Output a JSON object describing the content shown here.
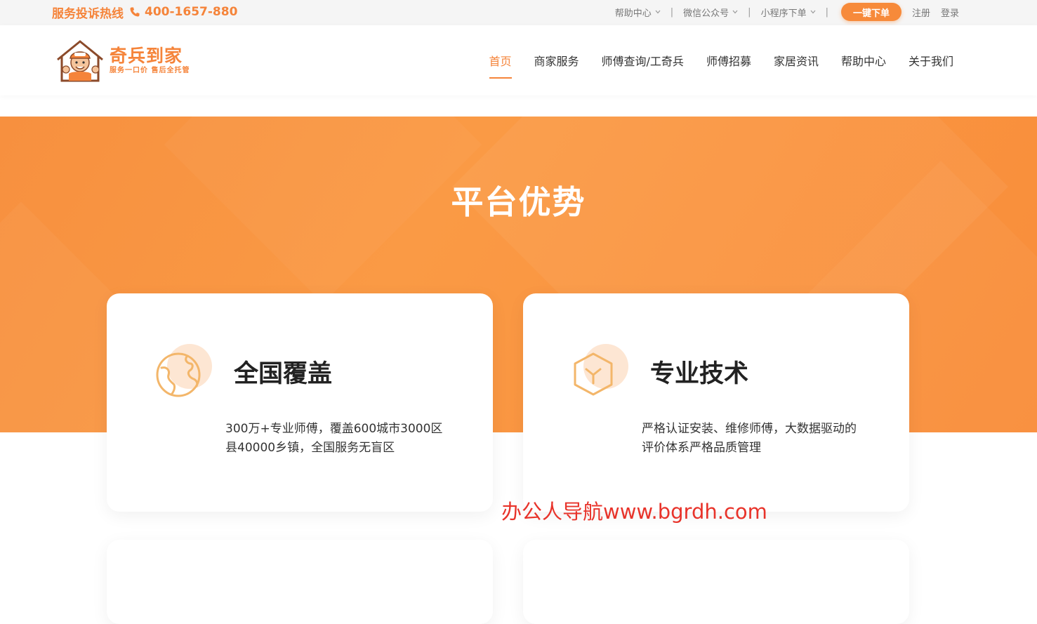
{
  "topbar": {
    "hotline_label": "服务投诉热线",
    "hotline_number": "400-1657-880",
    "links": {
      "help": "帮助中心",
      "wechat": "微信公众号",
      "miniprogram": "小程序下单"
    },
    "separator": "|",
    "order_button": "一键下单",
    "register": "注册",
    "login": "登录"
  },
  "logo": {
    "name": "奇兵到家",
    "slogan": "服务一口价  售后全托管"
  },
  "nav": {
    "items": [
      {
        "label": "首页"
      },
      {
        "label": "商家服务"
      },
      {
        "label": "师傅查询/工奇兵"
      },
      {
        "label": "师傅招募"
      },
      {
        "label": "家居资讯"
      },
      {
        "label": "帮助中心"
      },
      {
        "label": "关于我们"
      }
    ]
  },
  "hero": {
    "title": "平台优势"
  },
  "cards": [
    {
      "title": "全国覆盖",
      "desc": "300万+专业师傅，覆盖600城市3000区县40000乡镇，全国服务无盲区",
      "icon": "globe-icon"
    },
    {
      "title": "专业技术",
      "desc": "严格认证安装、维修师傅，大数据驱动的评价体系严格品质管理",
      "icon": "cube-icon"
    }
  ],
  "watermark": "办公人导航www.bgrdh.com",
  "colors": {
    "accent": "#f5843a",
    "hero_bg": "#f98d3a",
    "watermark": "#e8332a"
  }
}
